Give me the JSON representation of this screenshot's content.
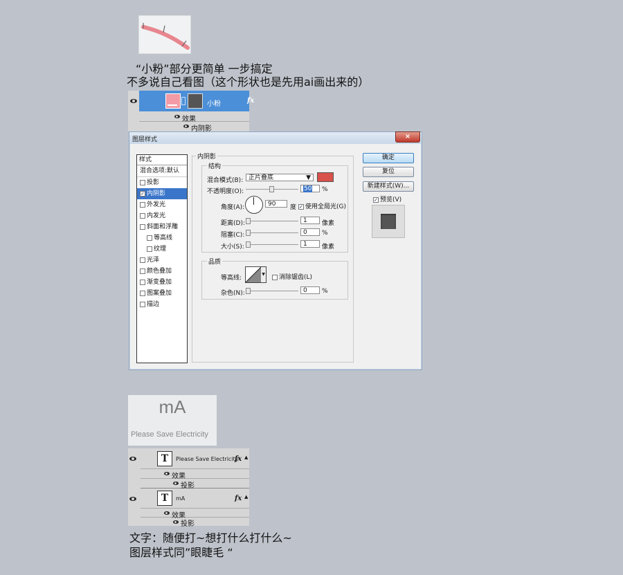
{
  "caption1": {
    "line1": "“小粉”部分更简单 一步搞定",
    "line2": "不多说自己看图（这个形状也是先用ai画出来的）"
  },
  "layer_panel_top": {
    "layer_name": "小粉",
    "fx_label": "fx",
    "effects_label": "效果",
    "inner_shadow_label": "内阴影"
  },
  "dialog": {
    "title": "图层样式",
    "close_label": "×",
    "styles_header": "样式",
    "blend_default": "混合选项:默认",
    "style_items": [
      {
        "label": "投影",
        "checked": false
      },
      {
        "label": "内阴影",
        "checked": true
      },
      {
        "label": "外发光",
        "checked": false
      },
      {
        "label": "内发光",
        "checked": false
      },
      {
        "label": "斜面和浮雕",
        "checked": false
      },
      {
        "label": "等高线",
        "checked": false
      },
      {
        "label": "纹理",
        "checked": false
      },
      {
        "label": "光泽",
        "checked": false
      },
      {
        "label": "颜色叠加",
        "checked": false
      },
      {
        "label": "渐变叠加",
        "checked": false
      },
      {
        "label": "图案叠加",
        "checked": false
      },
      {
        "label": "描边",
        "checked": false
      }
    ],
    "section_title": "内阴影",
    "structure_label": "结构",
    "blend_mode_label": "混合模式(B):",
    "blend_mode_value": "正片叠底",
    "shadow_color": "#d8514b",
    "opacity_label": "不透明度(O):",
    "opacity_value": "50",
    "percent": "%",
    "angle_label": "角度(A):",
    "angle_value": "90",
    "degree_label": "度",
    "global_light_label": "使用全局光(G)",
    "distance_label": "距离(D):",
    "distance_value": "1",
    "choke_label": "阻塞(C):",
    "choke_value": "0",
    "size_label": "大小(S):",
    "size_value": "1",
    "pixels_label": "像素",
    "quality_label": "品质",
    "contour_label": "等高线:",
    "antialias_label": "消除锯齿(L)",
    "noise_label": "杂色(N):",
    "noise_value": "0",
    "ok_label": "确定",
    "reset_label": "复位",
    "new_style_label": "新建样式(W)...",
    "preview_label": "预览(V)"
  },
  "ma_preview": {
    "big_text": "mA",
    "small_text": "Please Save Electricity"
  },
  "layer_panel_bottom": {
    "text_icon": "T",
    "layer1_name": "Please Save Electricity",
    "layer2_name": "mA",
    "fx_label": "fx",
    "effects_label": "效果",
    "drop_shadow_label": "投影"
  },
  "caption2": {
    "line1": "文字：随便打~想打什么打什么~",
    "line2": "图层样式同”眼睫毛 “"
  },
  "colors": {
    "background": "#bec3cb",
    "selection_blue": "#3a75c9",
    "pink_swatch": "#f29aa5"
  }
}
